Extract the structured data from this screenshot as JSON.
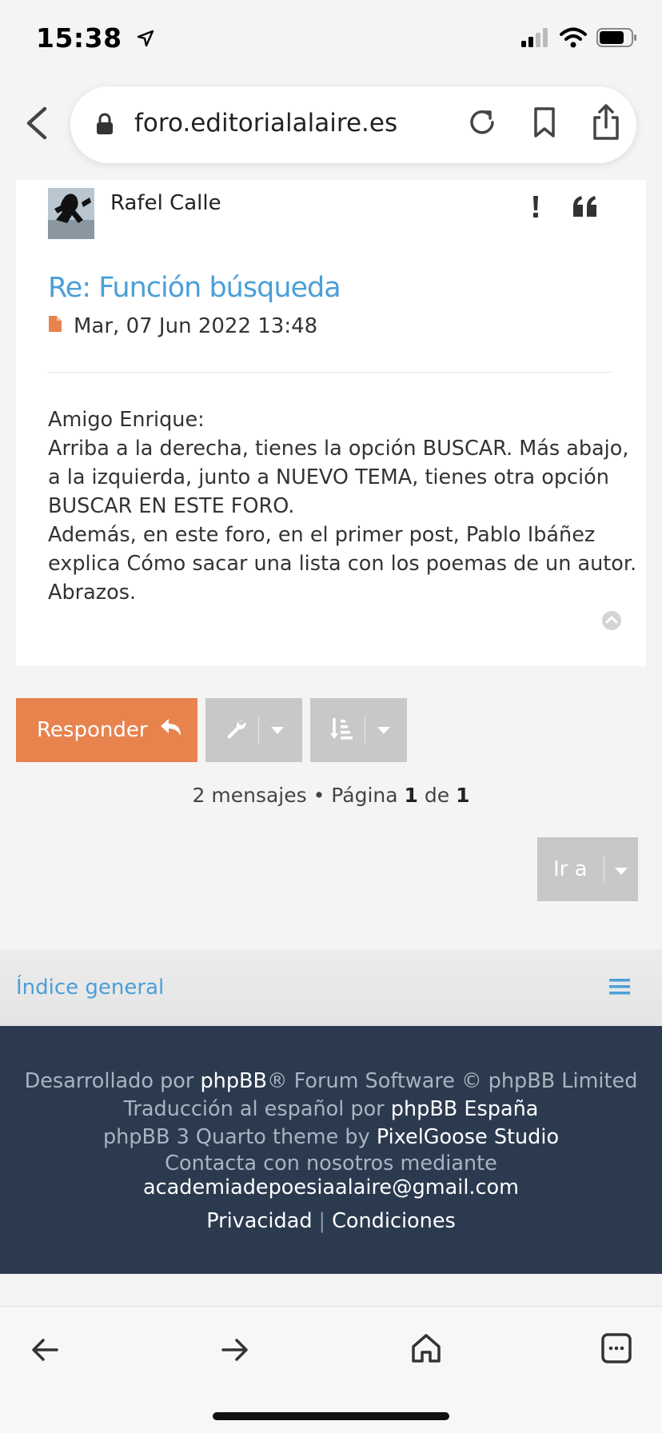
{
  "status": {
    "time": "15:38"
  },
  "browser": {
    "url": "foro.editorialalaire.es"
  },
  "post": {
    "author": "Rafel Calle",
    "title": "Re: Función búsqueda",
    "date": "Mar, 07 Jun 2022 13:48",
    "body": [
      "Amigo Enrique:",
      "Arriba a la derecha, tienes la opción BUSCAR. Más abajo,",
      "a la izquierda, junto a NUEVO TEMA, tienes otra opción",
      "BUSCAR EN ESTE FORO.",
      "Además, en este foro, en el primer post, Pablo Ibáñez",
      "explica Cómo sacar una lista con los poemas de un autor.",
      "Abrazos."
    ]
  },
  "actions": {
    "reply_label": "Responder",
    "pagination": {
      "prefix": "2 mensajes • Página ",
      "current": "1",
      "middle": " de ",
      "total": "1"
    },
    "goto_label": "Ir a"
  },
  "nav": {
    "index_label": "Índice general"
  },
  "footer": {
    "line1_prefix": "Desarrollado por ",
    "line1_link": "phpBB",
    "line1_suffix": "® Forum Software © phpBB Limited",
    "line2_prefix": "Traducción al español por ",
    "line2_link": "phpBB España",
    "line3_prefix": "phpBB 3 Quarto theme by ",
    "line3_link": "PixelGoose Studio",
    "line4": "Contacta con nosotros mediante",
    "email": "academiadepoesiaalaire@gmail.com",
    "privacy": "Privacidad",
    "separator": "|",
    "terms": "Condiciones"
  },
  "colors": {
    "accent": "#e8834e",
    "link": "#4a9fd8",
    "footer_bg": "#2b3a4f",
    "button_grey": "#c8c8c8"
  },
  "icons": [
    "location-arrow-icon",
    "signal-icon",
    "wifi-icon",
    "battery-icon",
    "chevron-left-icon",
    "lock-icon",
    "reload-icon",
    "bookmark-icon",
    "share-icon",
    "report-icon",
    "quote-icon",
    "post-file-icon",
    "scroll-top-icon",
    "reply-arrow-icon",
    "wrench-icon",
    "sort-icon",
    "caret-down-icon",
    "hamburger-menu-icon",
    "back-arrow-icon",
    "forward-arrow-icon",
    "home-icon",
    "tabs-icon"
  ]
}
